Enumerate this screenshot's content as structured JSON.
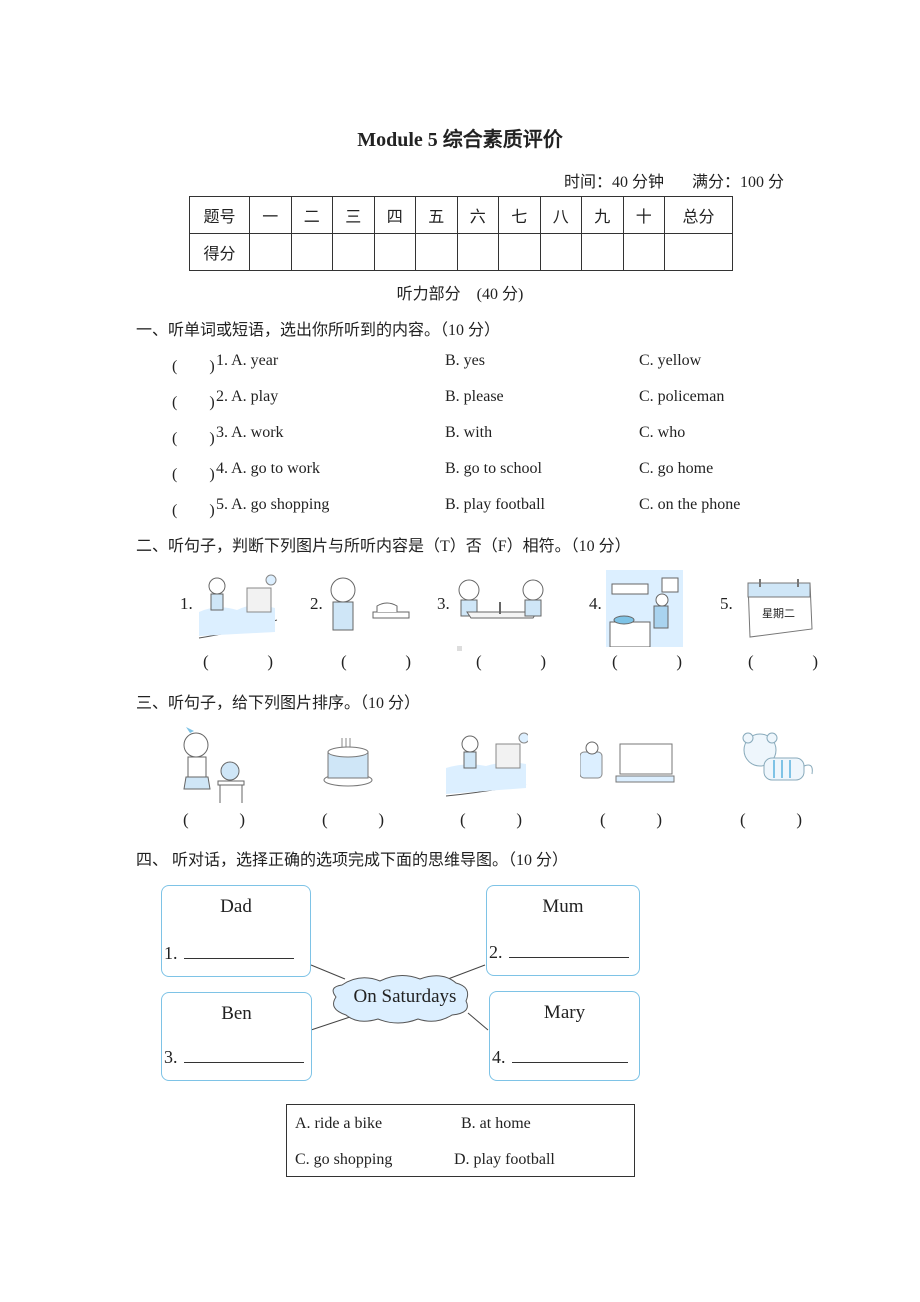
{
  "header": {
    "title": "Module 5  综合素质评价",
    "time_label": "时间：40 分钟",
    "full_score_label": "满分：100 分"
  },
  "score_table": {
    "header_row": [
      "题号",
      "一",
      "二",
      "三",
      "四",
      "五",
      "六",
      "七",
      "八",
      "九",
      "十",
      "总分"
    ],
    "score_row_label": "得分"
  },
  "listening_part": "听力部分　(40 分)",
  "section1": {
    "heading": "一、听单词或短语，选出你所听到的内容。（10  分）",
    "questions": [
      {
        "paren": "(　　)",
        "a": "1. A. year",
        "b": "B. yes",
        "c": "C. yellow"
      },
      {
        "paren": "(　　)",
        "a": "2. A. play",
        "b": "B. please",
        "c": "C. policeman"
      },
      {
        "paren": "(　　)",
        "a": "3. A. work",
        "b": "B. with",
        "c": "C. who"
      },
      {
        "paren": "(　　)",
        "a": "4. A. go to work",
        "b": "B. go to school",
        "c": "C. go home"
      },
      {
        "paren": "(　　)",
        "a": "5. A. go shopping",
        "b": "B. play football",
        "c": "C. on the phone"
      }
    ]
  },
  "section2": {
    "heading": "二、听句子，判断下列图片与所听内容是（T）否（F）相符。（10  分）",
    "items": [
      {
        "num": "1.",
        "picture": "boy-walking-to-school"
      },
      {
        "num": "2.",
        "picture": "girl-on-phone"
      },
      {
        "num": "3.",
        "picture": "kids-playing-table-tennis"
      },
      {
        "num": "4.",
        "picture": "man-cooking-in-kitchen"
      },
      {
        "num": "5.",
        "picture": "calendar-tuesday",
        "calendar_text": "星期二"
      }
    ],
    "blank": [
      "(",
      ")"
    ]
  },
  "section3": {
    "heading": "三、听句子，给下列图片排序。（10  分）",
    "items": [
      {
        "picture": "girl-on-telephone"
      },
      {
        "picture": "birthday-cake"
      },
      {
        "picture": "girl-walking-to-school"
      },
      {
        "picture": "person-watching-tv"
      },
      {
        "picture": "tiger"
      }
    ],
    "blank": [
      "(",
      ")"
    ]
  },
  "section4": {
    "heading": "四、  听对话，选择正确的选项完成下面的思维导图。（10  分）",
    "center": "On Saturdays",
    "boxes": [
      {
        "name": "Dad",
        "num": "1."
      },
      {
        "name": "Mum",
        "num": "2."
      },
      {
        "name": "Ben",
        "num": "3."
      },
      {
        "name": "Mary",
        "num": "4."
      }
    ],
    "options": [
      "A. ride a bike",
      "B. at home",
      "C. go shopping",
      "D. play football"
    ]
  },
  "colors": {
    "accent_blue": "#7ec3e6",
    "light_blue_fill": "#dcefff"
  }
}
